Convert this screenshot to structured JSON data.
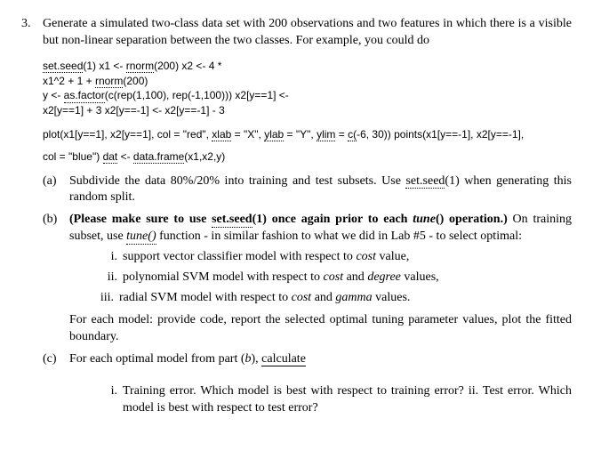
{
  "q_num": "3.",
  "q_text_1": "Generate a simulated two-class data set with 200 observations and two features in which there is a visible but non-linear separation between the two classes. For example, you could do",
  "code": {
    "l1a": "set.seed",
    "l1b": "(1) x1 <- ",
    "l1c": "rnorm",
    "l1d": "(200) x2 <- 4 *",
    "l2a": "x1^2 + 1 + ",
    "l2b": "rnorm",
    "l2c": "(200)",
    "l3a": "y <- ",
    "l3b": "as.factor",
    "l3c": "(c(rep(1,100), rep(-1,100))) x2[y==1] <-",
    "l4": "x2[y==1] + 3 x2[y==-1] <- x2[y==-1] - 3",
    "l5a": "plot(x1[y==1], x2[y==1], col = \"red\", ",
    "l5b": "xlab",
    "l5c": " = \"X\", ",
    "l5d": "ylab",
    "l5e": " = \"Y\", ",
    "l5f": "ylim",
    "l5g": " = ",
    "l5h": "c(",
    "l5i": "-6, 30)) points(x1[y==-1], x2[y==-1],",
    "l6a": "col = \"blue\") ",
    "l6b": "dat",
    "l6c": " <- ",
    "l6d": "data.frame",
    "l6e": "(x1,x2,y)"
  },
  "parts": {
    "a": {
      "lbl": "(a)",
      "t1": "Subdivide the data 80%/20% into training and test subsets. Use ",
      "t2": "set.seed",
      "t3": "(1) when generating this random split."
    },
    "b": {
      "lbl": "(b)",
      "t1": "(Please make sure to use ",
      "t2": "set.seed",
      "t3": "(1) once again prior to each ",
      "t4": "tune",
      "t5": "() operation.)",
      "t6": " On training subset, use ",
      "t7": "tune()",
      "t8": " function - in similar fashion to what we did in Lab #5 - to select optimal:",
      "i_lbl": "i.",
      "i_txt_a": "support vector classifier model with respect to ",
      "i_txt_b": "cost",
      "i_txt_c": " value,",
      "ii_lbl": "ii.",
      "ii_txt_a": "polynomial SVM model with respect to ",
      "ii_txt_b": "cost",
      "ii_txt_c": " and ",
      "ii_txt_d": "degree",
      "ii_txt_e": " values,",
      "iii_lbl": "iii.",
      "iii_txt_a": "radial SVM model with respect to ",
      "iii_txt_b": "cost",
      "iii_txt_c": " and ",
      "iii_txt_d": "gamma",
      "iii_txt_e": " values.",
      "tail": "For each model: provide code, report the selected optimal tuning parameter values, plot the fitted boundary."
    },
    "c": {
      "lbl": "(c)",
      "t1": "For each optimal model from part (",
      "t2": "b",
      "t3": "), ",
      "t4": "calculate",
      "i_lbl": "i.",
      "i_txt": "Training error. Which model is best with respect to training error? ii. Test error. Which model is best with respect to test error?"
    }
  }
}
